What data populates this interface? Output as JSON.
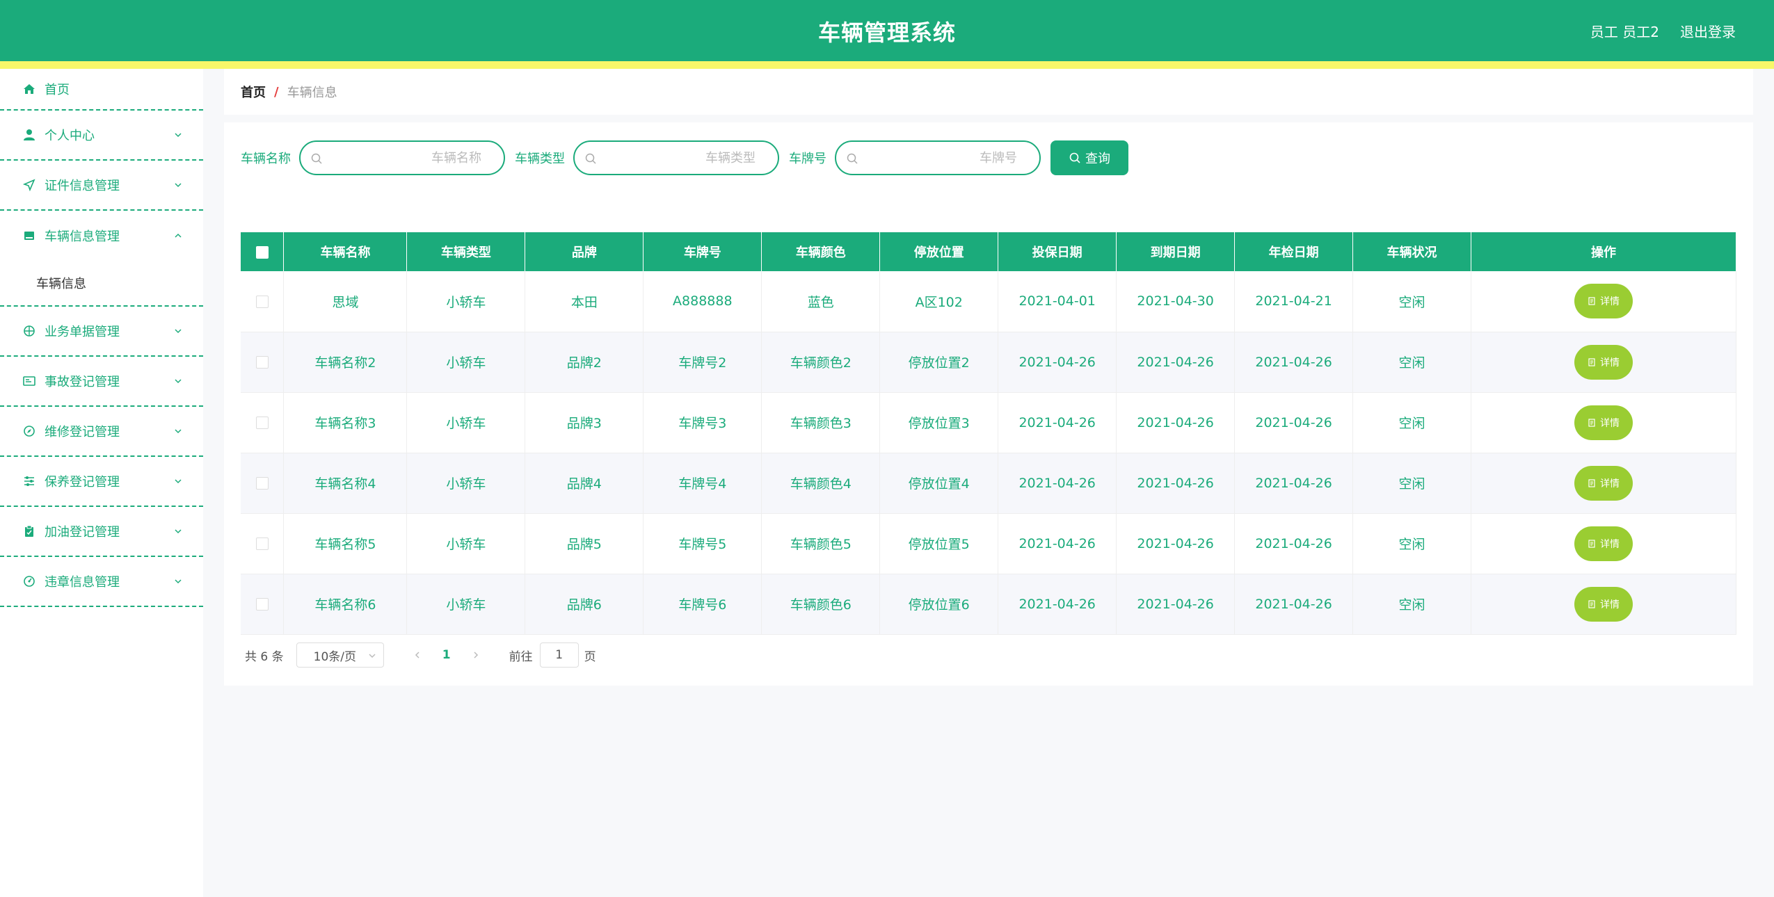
{
  "header": {
    "title": "车辆管理系统",
    "user": "员工 员工2",
    "logout": "退出登录"
  },
  "colors": {
    "primary": "#1bab7b",
    "accent_bar": "#f7f76a",
    "detail_button": "#9acd32"
  },
  "sidebar": {
    "items": [
      {
        "label": "首页",
        "icon": "home-icon"
      },
      {
        "label": "个人中心",
        "icon": "user-icon"
      },
      {
        "label": "证件信息管理",
        "icon": "send-icon"
      },
      {
        "label": "车辆信息管理",
        "icon": "printer-icon",
        "expanded": true,
        "children": [
          {
            "label": "车辆信息"
          }
        ]
      },
      {
        "label": "业务单据管理",
        "icon": "target-icon"
      },
      {
        "label": "事故登记管理",
        "icon": "card-icon"
      },
      {
        "label": "维修登记管理",
        "icon": "compass-icon"
      },
      {
        "label": "保养登记管理",
        "icon": "sliders-icon"
      },
      {
        "label": "加油登记管理",
        "icon": "clipboard-icon"
      },
      {
        "label": "违章信息管理",
        "icon": "gauge-icon"
      }
    ]
  },
  "breadcrumb": {
    "home": "首页",
    "separator": "/",
    "current": "车辆信息"
  },
  "search": {
    "name_label": "车辆名称",
    "name_placeholder": "车辆名称",
    "type_label": "车辆类型",
    "type_placeholder": "车辆类型",
    "plate_label": "车牌号",
    "plate_placeholder": "车牌号",
    "query_button": "查询"
  },
  "table": {
    "columns": [
      "车辆名称",
      "车辆类型",
      "品牌",
      "车牌号",
      "车辆颜色",
      "停放位置",
      "投保日期",
      "到期日期",
      "年检日期",
      "车辆状况",
      "操作"
    ],
    "detail_label": "详情",
    "rows": [
      [
        "思域",
        "小轿车",
        "本田",
        "A888888",
        "蓝色",
        "A区102",
        "2021-04-01",
        "2021-04-30",
        "2021-04-21",
        "空闲"
      ],
      [
        "车辆名称2",
        "小轿车",
        "品牌2",
        "车牌号2",
        "车辆颜色2",
        "停放位置2",
        "2021-04-26",
        "2021-04-26",
        "2021-04-26",
        "空闲"
      ],
      [
        "车辆名称3",
        "小轿车",
        "品牌3",
        "车牌号3",
        "车辆颜色3",
        "停放位置3",
        "2021-04-26",
        "2021-04-26",
        "2021-04-26",
        "空闲"
      ],
      [
        "车辆名称4",
        "小轿车",
        "品牌4",
        "车牌号4",
        "车辆颜色4",
        "停放位置4",
        "2021-04-26",
        "2021-04-26",
        "2021-04-26",
        "空闲"
      ],
      [
        "车辆名称5",
        "小轿车",
        "品牌5",
        "车牌号5",
        "车辆颜色5",
        "停放位置5",
        "2021-04-26",
        "2021-04-26",
        "2021-04-26",
        "空闲"
      ],
      [
        "车辆名称6",
        "小轿车",
        "品牌6",
        "车牌号6",
        "车辆颜色6",
        "停放位置6",
        "2021-04-26",
        "2021-04-26",
        "2021-04-26",
        "空闲"
      ]
    ]
  },
  "pagination": {
    "total": "共 6 条",
    "page_size": "10条/页",
    "current_page": "1",
    "goto_label": "前往",
    "goto_value": "1",
    "page_suffix": "页"
  }
}
